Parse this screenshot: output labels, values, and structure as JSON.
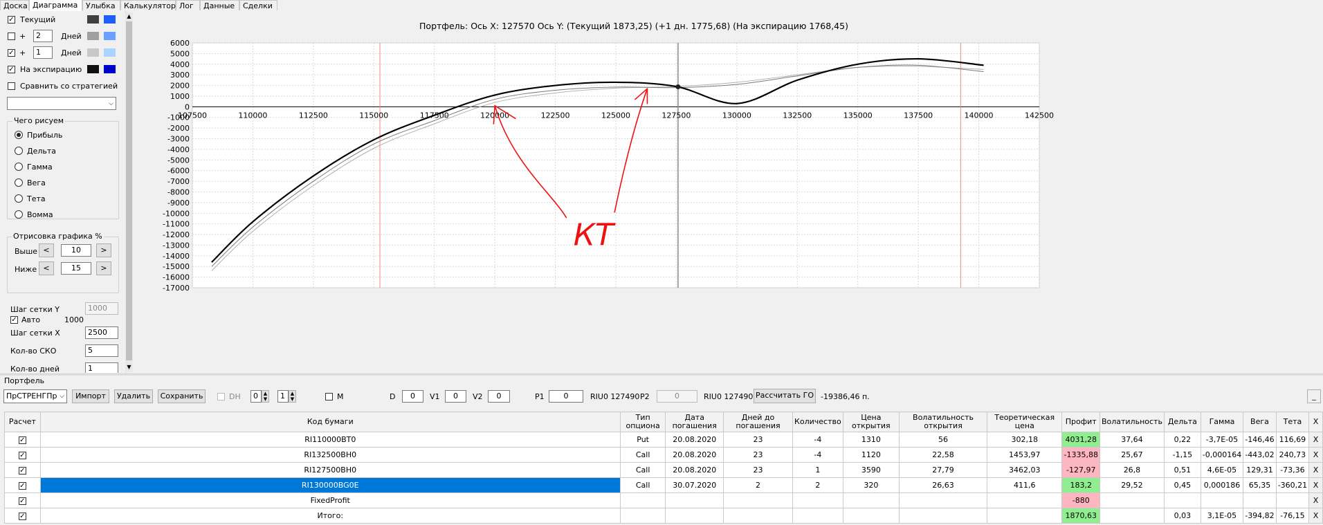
{
  "tabs": [
    "Доска",
    "Диаграмма",
    "Улыбка",
    "Калькулятор",
    "Лог",
    "Данные",
    "Сделки"
  ],
  "active_tab": 1,
  "left": {
    "current_label": "Текущий",
    "plus": "+",
    "days_label": "Дней",
    "days1": "2",
    "days2": "1",
    "expiration_label": "На экспирацию",
    "compare_label": "Сравнить со стратегией",
    "what_title": "Чего рисуем",
    "radios": [
      "Прибыль",
      "Дельта",
      "Гамма",
      "Вега",
      "Тета",
      "Вомма"
    ],
    "draw_title": "Отрисовка графика %",
    "above_label": "Выше",
    "above_value": "10",
    "below_label": "Ниже",
    "below_value": "15",
    "left_arrow": "<",
    "right_arrow": ">",
    "grid_y_label": "Шаг сетки Y",
    "grid_y_value": "1000",
    "auto_label": "Авто",
    "auto_value": "1000",
    "grid_x_label": "Шаг сетки X",
    "grid_x_value": "2500",
    "sko_label": "Кол-во СКО",
    "sko_value": "5",
    "days_cnt_label": "Кол-во дней",
    "days_cnt_value": "1",
    "colors": {
      "current": [
        "#404040",
        "#1e5eff"
      ],
      "plus1": [
        "#a0a0a0",
        "#6aa0ff"
      ],
      "plus2": [
        "#c8c8c8",
        "#a8d4ff"
      ],
      "exp": [
        "#101010",
        "#0000cc"
      ]
    }
  },
  "chart_data": {
    "type": "line",
    "title": "Портфель: Ось X: 127570 Ось Y:  (Текущий 1873,25)  (+1 дн. 1775,68)  (На экспирацию 1768,45)",
    "xlim": [
      107500,
      142500
    ],
    "ylim": [
      -17000,
      6000
    ],
    "xticks": [
      107500,
      110000,
      112500,
      115000,
      117500,
      120000,
      122500,
      125000,
      127500,
      130000,
      132500,
      135000,
      137500,
      140000,
      142500
    ],
    "yticks": [
      6000,
      5000,
      4000,
      3000,
      2000,
      1000,
      0,
      -1000,
      -2000,
      -3000,
      -4000,
      -5000,
      -6000,
      -7000,
      -8000,
      -9000,
      -10000,
      -11000,
      -12000,
      -13000,
      -14000,
      -15000,
      -16000,
      -17000
    ],
    "vlines_red": [
      115250,
      139250
    ],
    "cursor_x": 127570,
    "cursor_y": 1873,
    "annotation": "КТ",
    "series": [
      {
        "x": [
          108300,
          110000,
          112500,
          115000,
          117500,
          120000,
          122500,
          125000,
          127500,
          130000,
          132500,
          135000,
          137500,
          140200
        ],
        "y": [
          -14600,
          -10800,
          -6500,
          -3100,
          -800,
          1100,
          2000,
          2300,
          1900,
          300,
          2500,
          4000,
          4500,
          3900
        ],
        "color": "#000000",
        "width": 2.2
      },
      {
        "x": [
          108300,
          110000,
          112500,
          115000,
          117500,
          120000,
          122500,
          125000,
          127500,
          130000,
          132500,
          135000,
          137500,
          140200
        ],
        "y": [
          -15000,
          -11300,
          -7000,
          -3500,
          -1300,
          700,
          1550,
          1850,
          1800,
          2100,
          2900,
          3700,
          3900,
          3300
        ],
        "color": "#7a7a7a",
        "width": 1
      },
      {
        "x": [
          108300,
          110000,
          112500,
          115000,
          117500,
          120000,
          122500,
          125000,
          127500,
          130000,
          132500,
          135000,
          137500,
          140200
        ],
        "y": [
          -15400,
          -11700,
          -7400,
          -3900,
          -1600,
          400,
          1300,
          1750,
          1900,
          2300,
          3000,
          3700,
          3800,
          3500
        ],
        "color": "#b0b0b0",
        "width": 1
      }
    ]
  },
  "bottom": {
    "section_label": "Портфель",
    "portfolio_select": "ПрСТРЕНГПр",
    "import_btn": "Импорт",
    "delete_btn": "Удалить",
    "save_btn": "Сохранить",
    "dh_label": "DH",
    "dh_val1": "0",
    "dh_val2": "1",
    "m_label": "M",
    "d_label": "D",
    "d_val": "0",
    "v1_label": "V1",
    "v1_val": "0",
    "v2_label": "V2",
    "v2_val": "0",
    "p1_label": "P1",
    "p1_val": "0",
    "riu1": "RIU0 127490",
    "p2_label": "P2",
    "p2_val": "0",
    "riu2": "RIU0 127490",
    "calc_btn": "Рассчитать ГО",
    "go_value": "-19386,46 п.",
    "minimize": "_"
  },
  "table": {
    "headers": [
      "Расчет",
      "Код бумаги",
      "Тип опциона",
      "Дата погашения",
      "Дней до погашения",
      "Количество",
      "Цена открытия",
      "Волатильность открытия",
      "Теоретическая цена",
      "Профит",
      "Волатильность",
      "Дельта",
      "Гамма",
      "Вега",
      "Тета",
      "X"
    ],
    "rows": [
      [
        "RI110000BT0",
        "Put",
        "20.08.2020",
        "23",
        "-4",
        "1310",
        "56",
        "302,18",
        "4031,28",
        "37,64",
        "0,22",
        "-3,7E-05",
        "-146,46",
        "116,69",
        "X"
      ],
      [
        "RI132500BH0",
        "Call",
        "20.08.2020",
        "23",
        "-4",
        "1120",
        "22,58",
        "1453,97",
        "-1335,88",
        "25,67",
        "-1,15",
        "-0,000164",
        "-443,02",
        "240,73",
        "X"
      ],
      [
        "RI127500BH0",
        "Call",
        "20.08.2020",
        "23",
        "1",
        "3590",
        "27,79",
        "3462,03",
        "-127,97",
        "26,8",
        "0,51",
        "4,6E-05",
        "129,31",
        "-73,36",
        "X"
      ],
      [
        "RI130000BG0E",
        "Call",
        "30.07.2020",
        "2",
        "2",
        "320",
        "26,63",
        "411,6",
        "183,2",
        "29,52",
        "0,45",
        "0,000186",
        "65,35",
        "-360,21",
        "X"
      ],
      [
        "FixedProfit",
        "",
        "",
        "",
        "",
        "",
        "",
        "",
        "-880",
        "",
        "",
        "",
        "",
        "",
        "X"
      ],
      [
        "Итого:",
        "",
        "",
        "",
        "",
        "",
        "",
        "",
        "1870,63",
        "",
        "0,03",
        "3,1E-05",
        "-394,82",
        "-76,15",
        "X"
      ]
    ],
    "profit_sign": [
      "pos",
      "neg",
      "neg",
      "pos",
      "neg",
      "pos"
    ],
    "check_mark": "✓"
  }
}
